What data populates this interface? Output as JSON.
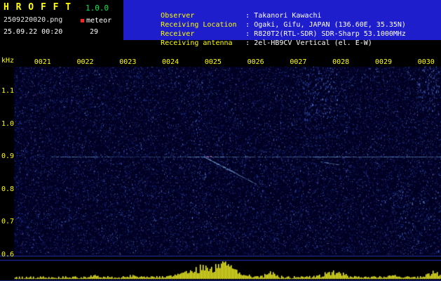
{
  "header": {
    "app_title": "H R O F F T",
    "version": "1.0.0",
    "filename": "2509220020.png",
    "mode_label": "meteor",
    "datetime": "25.09.22 00:20",
    "echo_count": "29"
  },
  "observer_info": {
    "rows": [
      {
        "label": "Observer",
        "value": ": Takanori Kawachi"
      },
      {
        "label": "Receiving Location",
        "value": ": Ogaki, Gifu, JAPAN (136.60E, 35.35N)"
      },
      {
        "label": "Receiver",
        "value": ": R820T2(RTL-SDR) SDR-Sharp 53.1000MHz"
      },
      {
        "label": "Receiving antenna",
        "value": ": 2el-HB9CV Vertical (el. E-W)"
      }
    ]
  },
  "chart_data": {
    "type": "heatmap",
    "subtype": "radio-meteor-echo-spectrogram",
    "title": "HROFFT 10-minute spectrogram 00:20-00:30",
    "x_ticks": [
      "0021",
      "0022",
      "0023",
      "0024",
      "0025",
      "0026",
      "0027",
      "0028",
      "0029",
      "0030"
    ],
    "time_span_min": 10.35,
    "y_axis_label": "kHz",
    "y_ticks": [
      "1.1",
      "1.0",
      "0.9",
      "0.8",
      "0.7",
      "0.6"
    ],
    "y_range_khz": [
      0.58,
      1.18
    ],
    "carrier_freq_khz": 0.9,
    "carrier_segments": [
      {
        "t0": 1.2,
        "t1": 2.55,
        "i": 0.7
      },
      {
        "t0": 2.55,
        "t1": 4.4,
        "i": 0.4
      },
      {
        "t0": 4.4,
        "t1": 5.25,
        "i": 1.0
      },
      {
        "t0": 5.25,
        "t1": 7.35,
        "i": 0.55
      },
      {
        "t0": 7.35,
        "t1": 8.3,
        "i": 0.95
      },
      {
        "t0": 8.3,
        "t1": 10.35,
        "i": 0.8
      }
    ],
    "echo_trails": [
      {
        "t0": 4.78,
        "f0": 0.9,
        "t1": 5.58,
        "f1": 0.848
      },
      {
        "t0": 4.9,
        "f0": 0.892,
        "t1": 6.02,
        "f1": 0.816
      },
      {
        "t0": 7.48,
        "f0": 0.886,
        "t1": 7.95,
        "f1": 0.876
      }
    ],
    "hot_spot": {
      "t": 4.85,
      "f": 0.9
    },
    "noise_columns": [
      {
        "t0": 7.1,
        "t1": 7.95,
        "f0": 1.18,
        "f1": 1.01,
        "count": 130
      },
      {
        "t0": 9.8,
        "t1": 10.3,
        "f0": 1.18,
        "f1": 1.04,
        "count": 90
      },
      {
        "t0": 4.5,
        "t1": 4.8,
        "f0": 1.18,
        "f1": 0.62,
        "count": 50
      },
      {
        "t0": 9.3,
        "t1": 10.3,
        "f0": 0.8,
        "f1": 0.6,
        "count": 60
      }
    ],
    "level_bursts": [
      {
        "t": 4.95,
        "w": 0.45,
        "amp": 22
      },
      {
        "t": 5.35,
        "w": 0.15,
        "amp": 14
      },
      {
        "t": 6.35,
        "w": 0.12,
        "amp": 7
      },
      {
        "t": 7.85,
        "w": 0.22,
        "amp": 11
      },
      {
        "t": 9.2,
        "w": 0.1,
        "amp": 5
      },
      {
        "t": 10.15,
        "w": 0.15,
        "amp": 10
      },
      {
        "t": 2.2,
        "w": 0.08,
        "amp": 4
      },
      {
        "t": 3.1,
        "w": 0.06,
        "amp": 4
      }
    ],
    "palette": {
      "bg": "#000022",
      "noise1": "#141e78",
      "noise2": "#2840b4",
      "noise3": "#4668dc",
      "noise4": "#78a0ff",
      "rare": "#c060e0",
      "carrier": "#8cc8ff",
      "hot": "#ff7bb0",
      "bars": "#ffff00",
      "grid": "#2233cc"
    }
  },
  "colors": {
    "title_yellow": "#ffff00",
    "version_green": "#00ee44",
    "info_box_blue": "#1e1ecc",
    "record_dot_red": "#ff2020",
    "value_white": "#ffffff"
  }
}
